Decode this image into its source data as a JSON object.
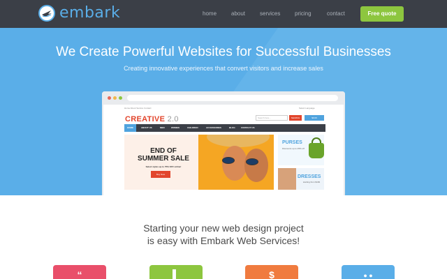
{
  "brand": {
    "logo_text": "embark",
    "logo_icon": "plane-globe-icon",
    "accent": "#5aaee8"
  },
  "nav": {
    "links": [
      "home",
      "about",
      "services",
      "pricing",
      "contact"
    ],
    "cta_label": "Free quote",
    "cta_color": "#8dc63f",
    "background": "#3b3f47"
  },
  "hero": {
    "title": "We Create Powerful Websites for Successful Businesses",
    "subtitle": "Creating innovative experiences that convert visitors and increase sales",
    "background": "#5aaee8"
  },
  "mockup": {
    "top_links": "Home   About   Service   Contact",
    "language": "Select Language",
    "brand_name": "CREATIVE",
    "brand_version": "2.0",
    "search_placeholder": "Search here...",
    "search_button": "SEARCH",
    "cart_label": "$0.00",
    "menu": [
      "HOME",
      "ABOUT US",
      "MEN",
      "WOMEN",
      "CHILDREN",
      "ACCESSORIES",
      "BLOG",
      "CONTACT US"
    ],
    "banner": {
      "title_line1": "END OF",
      "title_line2": "SUMMER SALE",
      "subtitle": "Select styles up to 75% OFF online!",
      "button": "Buy Now"
    },
    "side_cards": [
      {
        "title": "PURSES",
        "subtitle": "Discounts up to 25% off"
      },
      {
        "title": "DRESSES",
        "subtitle": "starting from $199"
      }
    ]
  },
  "lower": {
    "title_line1": "Starting your new web design project",
    "title_line2": "is easy with Embark Web Services!",
    "features": [
      {
        "icon": "quote-icon",
        "glyph": "“",
        "color": "#e94f6a"
      },
      {
        "icon": "phone-icon",
        "glyph": "▌",
        "color": "#8dc63f"
      },
      {
        "icon": "dollar-icon",
        "glyph": "$",
        "color": "#f07b3f"
      },
      {
        "icon": "social-icon",
        "glyph": "● ●",
        "color": "#5aaee8"
      }
    ]
  }
}
